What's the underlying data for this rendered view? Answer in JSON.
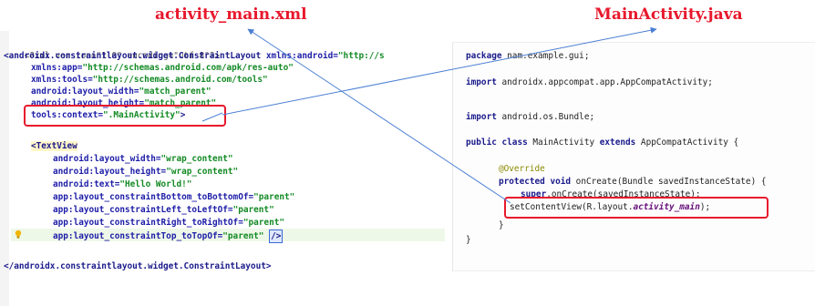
{
  "titles": {
    "left": "activity_main.xml",
    "right": "MainActivity.java"
  },
  "xml": {
    "decl": "<?xml version=\"1.0\" encoding=\"utf-8\"?>",
    "root_open_tag": "<androidx.constraintlayout.widget.ConstraintLayout",
    "root_ns_attr": "xmlns:android=",
    "root_ns_val": "\"http://s",
    "app_attr": "xmlns:app=",
    "app_val": "\"http://schemas.android.com/apk/res-auto\"",
    "tools_attr": "xmlns:tools=",
    "tools_val": "\"http://schemas.android.com/tools\"",
    "width_attr": "android:layout_width=",
    "width_val": "\"match_parent\"",
    "height_attr": "android:layout_height=",
    "height_val": "\"match_parent\"",
    "context_attr": "tools:context=",
    "context_val": "\".MainActivity\"",
    "context_end": ">",
    "textview_tag": "<TextView",
    "tv_attrs": [
      {
        "attr": "android:layout_width=",
        "val": "\"wrap_content\""
      },
      {
        "attr": "android:layout_height=",
        "val": "\"wrap_content\""
      },
      {
        "attr": "android:text=",
        "val": "\"Hello World!\""
      },
      {
        "attr": "app:layout_constraintBottom_toBottomOf=",
        "val": "\"parent\""
      },
      {
        "attr": "app:layout_constraintLeft_toLeftOf=",
        "val": "\"parent\""
      },
      {
        "attr": "app:layout_constraintRight_toRightOf=",
        "val": "\"parent\""
      },
      {
        "attr": "app:layout_constraintTop_toTopOf=",
        "val": "\"parent\""
      }
    ],
    "self_close": "/>",
    "root_close": "</androidx.constraintlayout.widget.ConstraintLayout>"
  },
  "java": {
    "package_kw": "package",
    "package_name": " nam.example.gui;",
    "import_kw": "import",
    "import1": " androidx.appcompat.app.AppCompatActivity;",
    "import2": " android.os.Bundle;",
    "class_decl_kw": "public class",
    "class_name": " MainActivity ",
    "extends_kw": "extends",
    "parent_class": " AppCompatActivity {",
    "annotation": "@Override",
    "method_kw": "protected void",
    "method_sig": " onCreate(Bundle savedInstanceState) {",
    "super_kw": "super",
    "super_call": ".onCreate(savedInstanceState);",
    "setcontent_pre": "setContentView(R.layout.",
    "setcontent_ital": "activity_main",
    "setcontent_post": ");",
    "close1": "}",
    "close2": "}"
  },
  "colors": {
    "accent_red": "#e8182c",
    "arrow_blue": "#4a7fd4"
  }
}
